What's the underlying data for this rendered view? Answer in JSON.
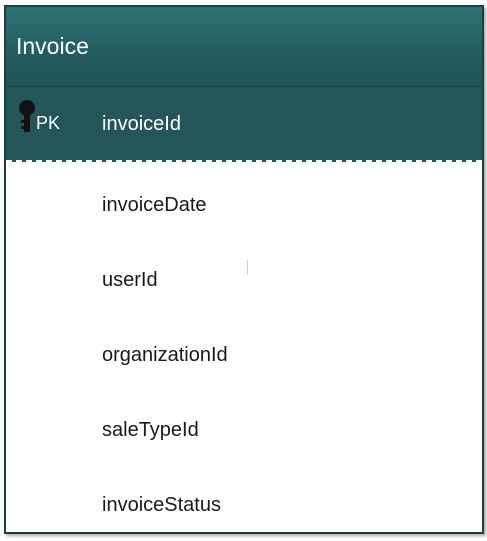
{
  "entity": {
    "name": "Invoice",
    "primary_key": {
      "badge": "PK",
      "icon": "key-icon",
      "name": "invoiceId"
    },
    "fields": [
      "invoiceDate",
      "userId",
      "organizationId",
      "saleTypeId",
      "invoiceStatus"
    ]
  },
  "colors": {
    "header": "#245e62",
    "pk_row": "#245659",
    "border": "#1d3f40",
    "text": "#1a1a1a"
  }
}
